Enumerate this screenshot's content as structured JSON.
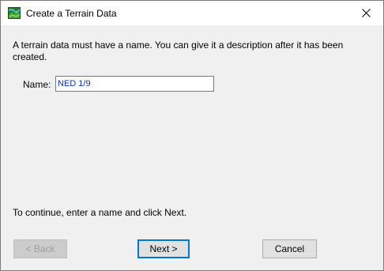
{
  "window": {
    "title": "Create a Terrain Data",
    "app_icon": "terrain-map-icon",
    "close_icon": "close-icon"
  },
  "dialog": {
    "instructions": "A terrain data must have a name. You can give it a description after it has been created.",
    "name_label": "Name:",
    "name_value": "NED 1/9",
    "hint": "To continue, enter a name and click Next."
  },
  "buttons": {
    "back_label": "< Back",
    "next_label": "Next >",
    "cancel_label": "Cancel"
  },
  "colors": {
    "input_text": "#0033cc",
    "focus_border": "#0078d7",
    "dialog_bg": "#f0f0f0"
  }
}
